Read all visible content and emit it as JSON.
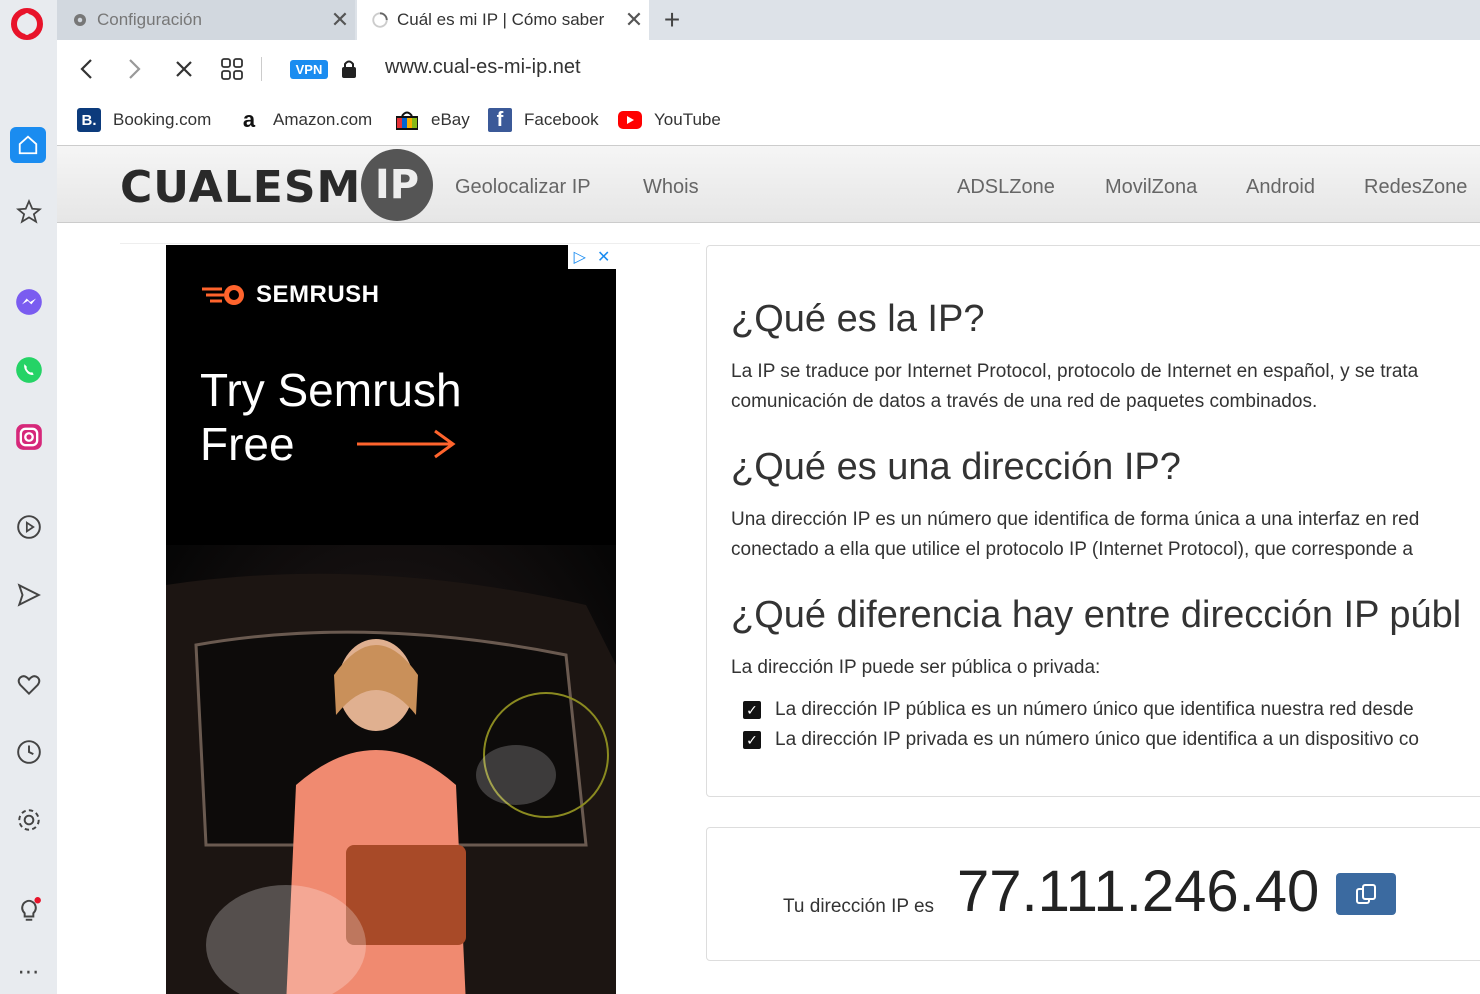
{
  "browser": {
    "tabs": [
      {
        "title": "Configuración",
        "active": false
      },
      {
        "title": "Cuál es mi IP | Cómo saber",
        "active": true
      }
    ],
    "vpn_label": "VPN",
    "url": "www.cual-es-mi-ip.net",
    "bookmarks": [
      "Booking.com",
      "Amazon.com",
      "eBay",
      "Facebook",
      "YouTube"
    ],
    "accent_color": "#1a8cf0"
  },
  "site": {
    "logo_text": "CUALESMI",
    "logo_circle": "IP",
    "nav_left": [
      "Geolocalizar IP",
      "Whois"
    ],
    "nav_right": [
      "ADSLZone",
      "MovilZona",
      "Android",
      "RedesZone"
    ]
  },
  "ad": {
    "brand": "SEMRUSH",
    "headline_line1": "Try Semrush",
    "headline_line2": "Free"
  },
  "content": {
    "h1": "¿Qué es la IP?",
    "p1_line1": "La IP se traduce por Internet Protocol, protocolo de Internet en español, y se trata",
    "p1_line2": "comunicación de datos a través de una red de paquetes combinados.",
    "h2": "¿Qué es una dirección IP?",
    "p2_line1": "Una dirección IP es un número que identifica de forma única a una interfaz en red",
    "p2_line2": "conectado a ella que utilice el protocolo IP (Internet Protocol), que corresponde a",
    "h3": "¿Qué diferencia hay entre dirección IP públ",
    "p3": "La dirección IP puede ser pública o privada:",
    "checks": [
      "La dirección IP pública es un número único que identifica nuestra red desde",
      "La dirección IP privada es un número único que identifica a un dispositivo co"
    ]
  },
  "ip": {
    "label": "Tu dirección IP es",
    "value": "77.111.246.40"
  }
}
